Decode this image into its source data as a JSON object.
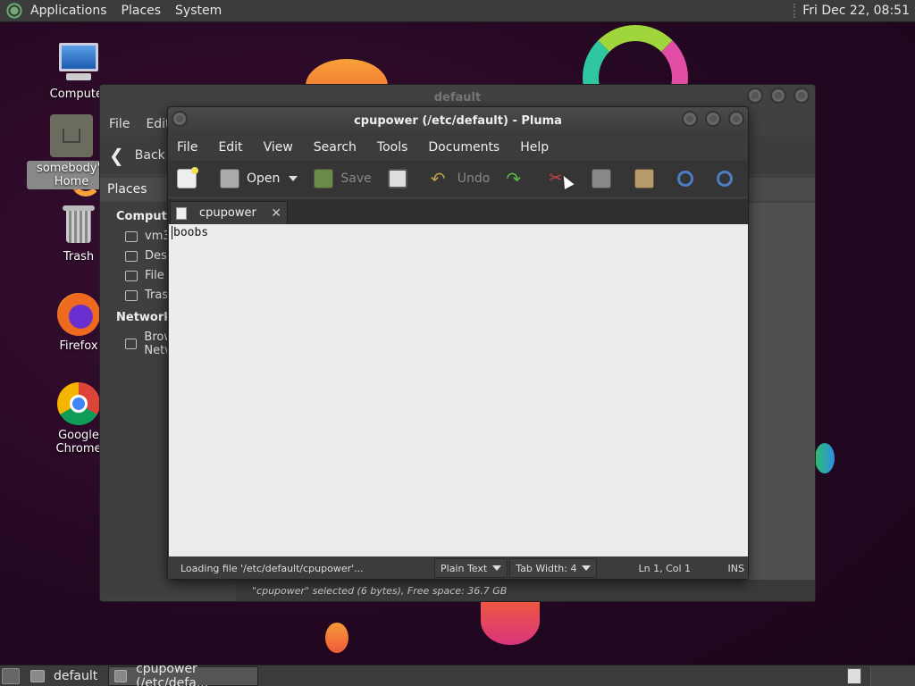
{
  "top_panel": {
    "menus": [
      "Applications",
      "Places",
      "System"
    ],
    "clock": "Fri Dec 22, 08:51"
  },
  "desktop_icons": [
    {
      "label": "Computer",
      "icon": "computer-icon"
    },
    {
      "label": "somebody's Home",
      "icon": "home-folder-icon"
    },
    {
      "label": "Trash",
      "icon": "trash-icon"
    },
    {
      "label": "Firefox",
      "icon": "firefox-icon"
    },
    {
      "label": "Google Chrome",
      "icon": "chrome-icon"
    }
  ],
  "file_manager": {
    "title": "default",
    "menus": [
      "File",
      "Edit"
    ],
    "back_label": "Back",
    "places_label": "Places",
    "sidebar": {
      "computer_section": "Computer",
      "computer_items": [
        "vm3",
        "Desktop",
        "File System",
        "Trash"
      ],
      "network_section": "Network",
      "network_items": [
        "Browse Network"
      ]
    },
    "status": "\"cpupower\" selected (6 bytes), Free space: 36.7 GB"
  },
  "pluma": {
    "title": "cpupower (/etc/default) - Pluma",
    "menus": [
      "File",
      "Edit",
      "View",
      "Search",
      "Tools",
      "Documents",
      "Help"
    ],
    "toolbar": {
      "open_label": "Open",
      "save_label": "Save",
      "undo_label": "Undo"
    },
    "tab_label": "cpupower",
    "content": "boobs",
    "status": {
      "message": "Loading file '/etc/default/cpupower'...",
      "language": "Plain Text",
      "tab_width": "Tab Width:  4",
      "position": "Ln 1, Col 1",
      "mode": "INS"
    }
  },
  "taskbar": {
    "tasks": [
      {
        "label": "default",
        "active": false
      },
      {
        "label": "cpupower (/etc/defa...",
        "active": true
      }
    ]
  }
}
